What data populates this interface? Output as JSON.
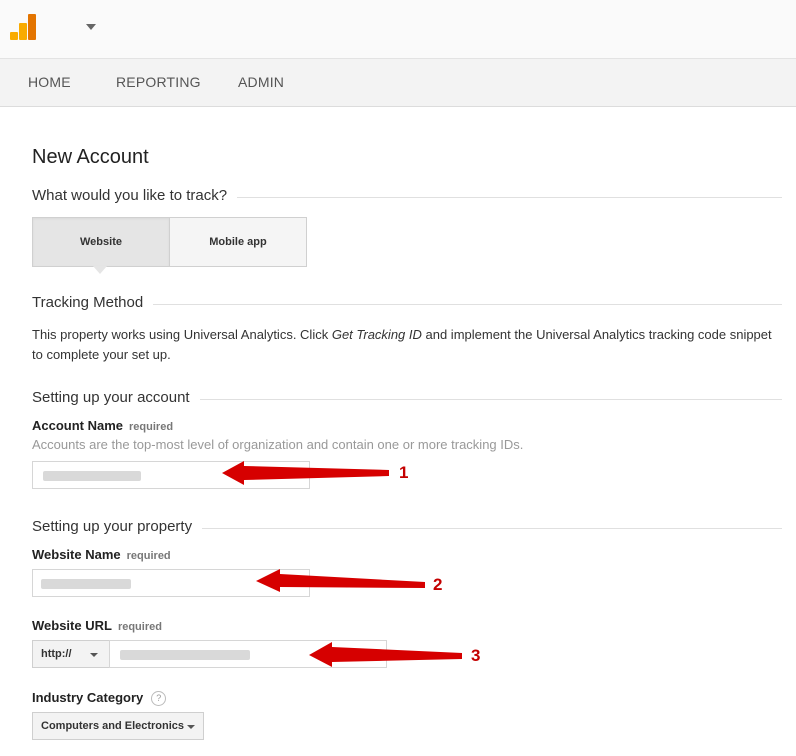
{
  "header": {
    "logo_icon": "google-analytics-logo-icon",
    "account_caret_icon": "caret-down-icon"
  },
  "nav": {
    "items": [
      {
        "label": "HOME"
      },
      {
        "label": "REPORTING"
      },
      {
        "label": "ADMIN"
      }
    ]
  },
  "page": {
    "title": "New Account",
    "track_question": "What would you like to track?",
    "track_options": [
      {
        "label": "Website",
        "selected": true
      },
      {
        "label": "Mobile app",
        "selected": false
      }
    ],
    "tracking_method": {
      "heading": "Tracking Method",
      "text_before": "This property works using Universal Analytics. Click ",
      "text_italic": "Get Tracking ID",
      "text_after": " and implement the Universal Analytics tracking code snippet to complete your set up."
    },
    "account_section": {
      "heading": "Setting up your account",
      "account_name_label": "Account Name",
      "required": "required",
      "account_name_help": "Accounts are the top-most level of organization and contain one or more tracking IDs."
    },
    "property_section": {
      "heading": "Setting up your property",
      "website_name_label": "Website Name",
      "website_url_label": "Website URL",
      "required": "required",
      "protocol_value": "http://",
      "industry_label": "Industry Category",
      "industry_help_icon": "?",
      "industry_value": "Computers and Electronics"
    }
  },
  "annotations": {
    "numbers": [
      "1",
      "2",
      "3"
    ],
    "color": "#d60000"
  }
}
